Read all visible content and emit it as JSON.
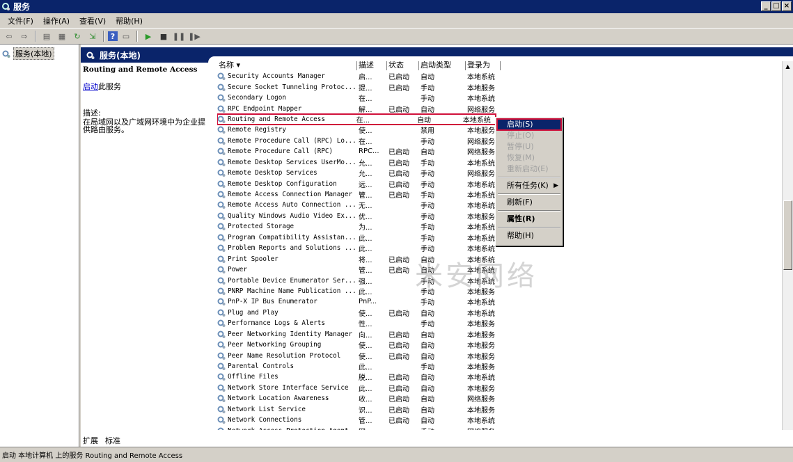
{
  "window": {
    "title": "服务",
    "min_icon": "minimize-icon",
    "max_icon": "maximize-icon",
    "close_icon": "close-icon"
  },
  "menu": [
    "文件(F)",
    "操作(A)",
    "查看(V)",
    "帮助(H)"
  ],
  "toolbar": {
    "icons": [
      "back-icon",
      "forward-icon",
      "show-tree-icon",
      "properties-icon",
      "refresh-icon",
      "export-icon",
      "help-icon",
      "console-icon",
      "start-icon",
      "stop-icon",
      "pause-icon",
      "restart-icon"
    ]
  },
  "tree": {
    "root_label": "服务(本地)"
  },
  "main_header": "服务(本地)",
  "desc_pane": {
    "service_title": "Routing and Remote Access",
    "start_link": "启动",
    "start_suffix": "此服务",
    "desc_label": "描述:",
    "desc_text": "在局域网以及广域网环境中为企业提供路由服务。"
  },
  "columns": [
    "名称",
    "描述",
    "状态",
    "启动类型",
    "登录为"
  ],
  "rows": [
    [
      "Security Accounts Manager",
      "启...",
      "已启动",
      "自动",
      "本地系统"
    ],
    [
      "Secure Socket Tunneling Protoc...",
      "提...",
      "已启动",
      "手动",
      "本地服务"
    ],
    [
      "Secondary Logon",
      "在...",
      "",
      "手动",
      "本地系统"
    ],
    [
      "RPC Endpoint Mapper",
      "解...",
      "已启动",
      "自动",
      "网络服务"
    ],
    [
      "Routing and Remote Access",
      "在...",
      "",
      "自动",
      "本地系统"
    ],
    [
      "Remote Registry",
      "使...",
      "",
      "禁用",
      "本地服务"
    ],
    [
      "Remote Procedure Call (RPC) Lo...",
      "在...",
      "",
      "手动",
      "网络服务"
    ],
    [
      "Remote Procedure Call (RPC)",
      "RPC...",
      "已启动",
      "自动",
      "网络服务"
    ],
    [
      "Remote Desktop Services UserMo...",
      "允...",
      "已启动",
      "手动",
      "本地系统"
    ],
    [
      "Remote Desktop Services",
      "允...",
      "已启动",
      "手动",
      "网络服务"
    ],
    [
      "Remote Desktop Configuration",
      "远...",
      "已启动",
      "手动",
      "本地系统"
    ],
    [
      "Remote Access Connection Manager",
      "管...",
      "已启动",
      "手动",
      "本地系统"
    ],
    [
      "Remote Access Auto Connection ...",
      "无...",
      "",
      "手动",
      "本地系统"
    ],
    [
      "Quality Windows Audio Video Ex...",
      "优...",
      "",
      "手动",
      "本地服务"
    ],
    [
      "Protected Storage",
      "为...",
      "",
      "手动",
      "本地系统"
    ],
    [
      "Program Compatibility Assistan...",
      "此...",
      "",
      "手动",
      "本地系统"
    ],
    [
      "Problem Reports and Solutions ...",
      "此...",
      "",
      "手动",
      "本地系统"
    ],
    [
      "Print Spooler",
      "将...",
      "已启动",
      "自动",
      "本地系统"
    ],
    [
      "Power",
      "管...",
      "已启动",
      "自动",
      "本地系统"
    ],
    [
      "Portable Device Enumerator Ser...",
      "强...",
      "",
      "手动",
      "本地系统"
    ],
    [
      "PNRP Machine Name Publication ...",
      "此...",
      "",
      "手动",
      "本地服务"
    ],
    [
      "PnP-X IP Bus Enumerator",
      "PnP...",
      "",
      "手动",
      "本地系统"
    ],
    [
      "Plug and Play",
      "使...",
      "已启动",
      "自动",
      "本地系统"
    ],
    [
      "Performance Logs & Alerts",
      "性...",
      "",
      "手动",
      "本地服务"
    ],
    [
      "Peer Networking Identity Manager",
      "向...",
      "已启动",
      "自动",
      "本地服务"
    ],
    [
      "Peer Networking Grouping",
      "使...",
      "已启动",
      "自动",
      "本地服务"
    ],
    [
      "Peer Name Resolution Protocol",
      "使...",
      "已启动",
      "自动",
      "本地服务"
    ],
    [
      "Parental Controls",
      "此...",
      "",
      "手动",
      "本地服务"
    ],
    [
      "Offline Files",
      "脱...",
      "已启动",
      "自动",
      "本地系统"
    ],
    [
      "Network Store Interface Service",
      "此...",
      "已启动",
      "自动",
      "本地服务"
    ],
    [
      "Network Location Awareness",
      "收...",
      "已启动",
      "自动",
      "网络服务"
    ],
    [
      "Network List Service",
      "识...",
      "已启动",
      "自动",
      "本地服务"
    ],
    [
      "Network Connections",
      "管...",
      "已启动",
      "自动",
      "本地系统"
    ],
    [
      "Network Access Protection Agent",
      "网...",
      "",
      "手动",
      "网络服务"
    ]
  ],
  "context_menu": {
    "start": "启动(S)",
    "stop": "停止(O)",
    "pause": "暂停(U)",
    "resume": "恢复(M)",
    "restart": "重新启动(E)",
    "all_tasks": "所有任务(K)",
    "refresh": "刷新(F)",
    "properties": "属性(R)",
    "help": "帮助(H)"
  },
  "tabs": [
    "扩展",
    "标准"
  ],
  "status": "启动 本地计算机 上的服务 Routing and Remote Access",
  "watermark": "米安网络",
  "colors": {
    "title_bg": "#0a246a",
    "highlight": "#d0103a",
    "chrome": "#d4d0c8"
  }
}
